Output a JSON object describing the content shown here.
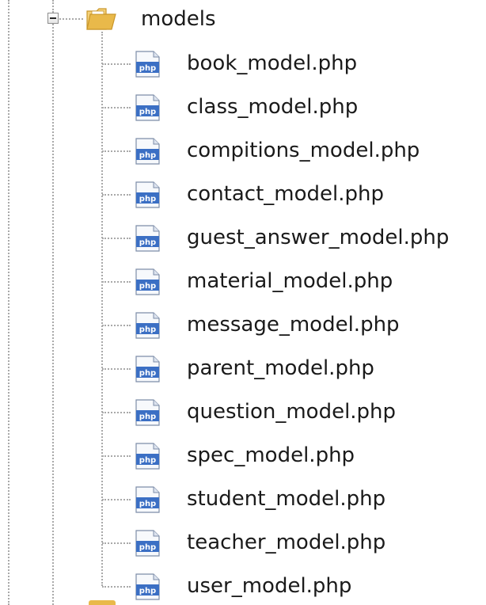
{
  "tree": {
    "folder": {
      "label": "models",
      "icon": "folder-open-icon",
      "expanded": true
    },
    "files": [
      {
        "label": "book_model.php",
        "icon": "php-file-icon"
      },
      {
        "label": "class_model.php",
        "icon": "php-file-icon"
      },
      {
        "label": "compitions_model.php",
        "icon": "php-file-icon"
      },
      {
        "label": "contact_model.php",
        "icon": "php-file-icon"
      },
      {
        "label": "guest_answer_model.php",
        "icon": "php-file-icon"
      },
      {
        "label": "material_model.php",
        "icon": "php-file-icon"
      },
      {
        "label": "message_model.php",
        "icon": "php-file-icon"
      },
      {
        "label": "parent_model.php",
        "icon": "php-file-icon"
      },
      {
        "label": "question_model.php",
        "icon": "php-file-icon"
      },
      {
        "label": "spec_model.php",
        "icon": "php-file-icon"
      },
      {
        "label": "student_model.php",
        "icon": "php-file-icon"
      },
      {
        "label": "teacher_model.php",
        "icon": "php-file-icon"
      },
      {
        "label": "user_model.php",
        "icon": "php-file-icon"
      }
    ],
    "icon_text": "php"
  },
  "colors": {
    "folder": "#e9b94a",
    "php_icon_blue": "#3b6fc4",
    "tree_lines": "#a9a9a9"
  }
}
